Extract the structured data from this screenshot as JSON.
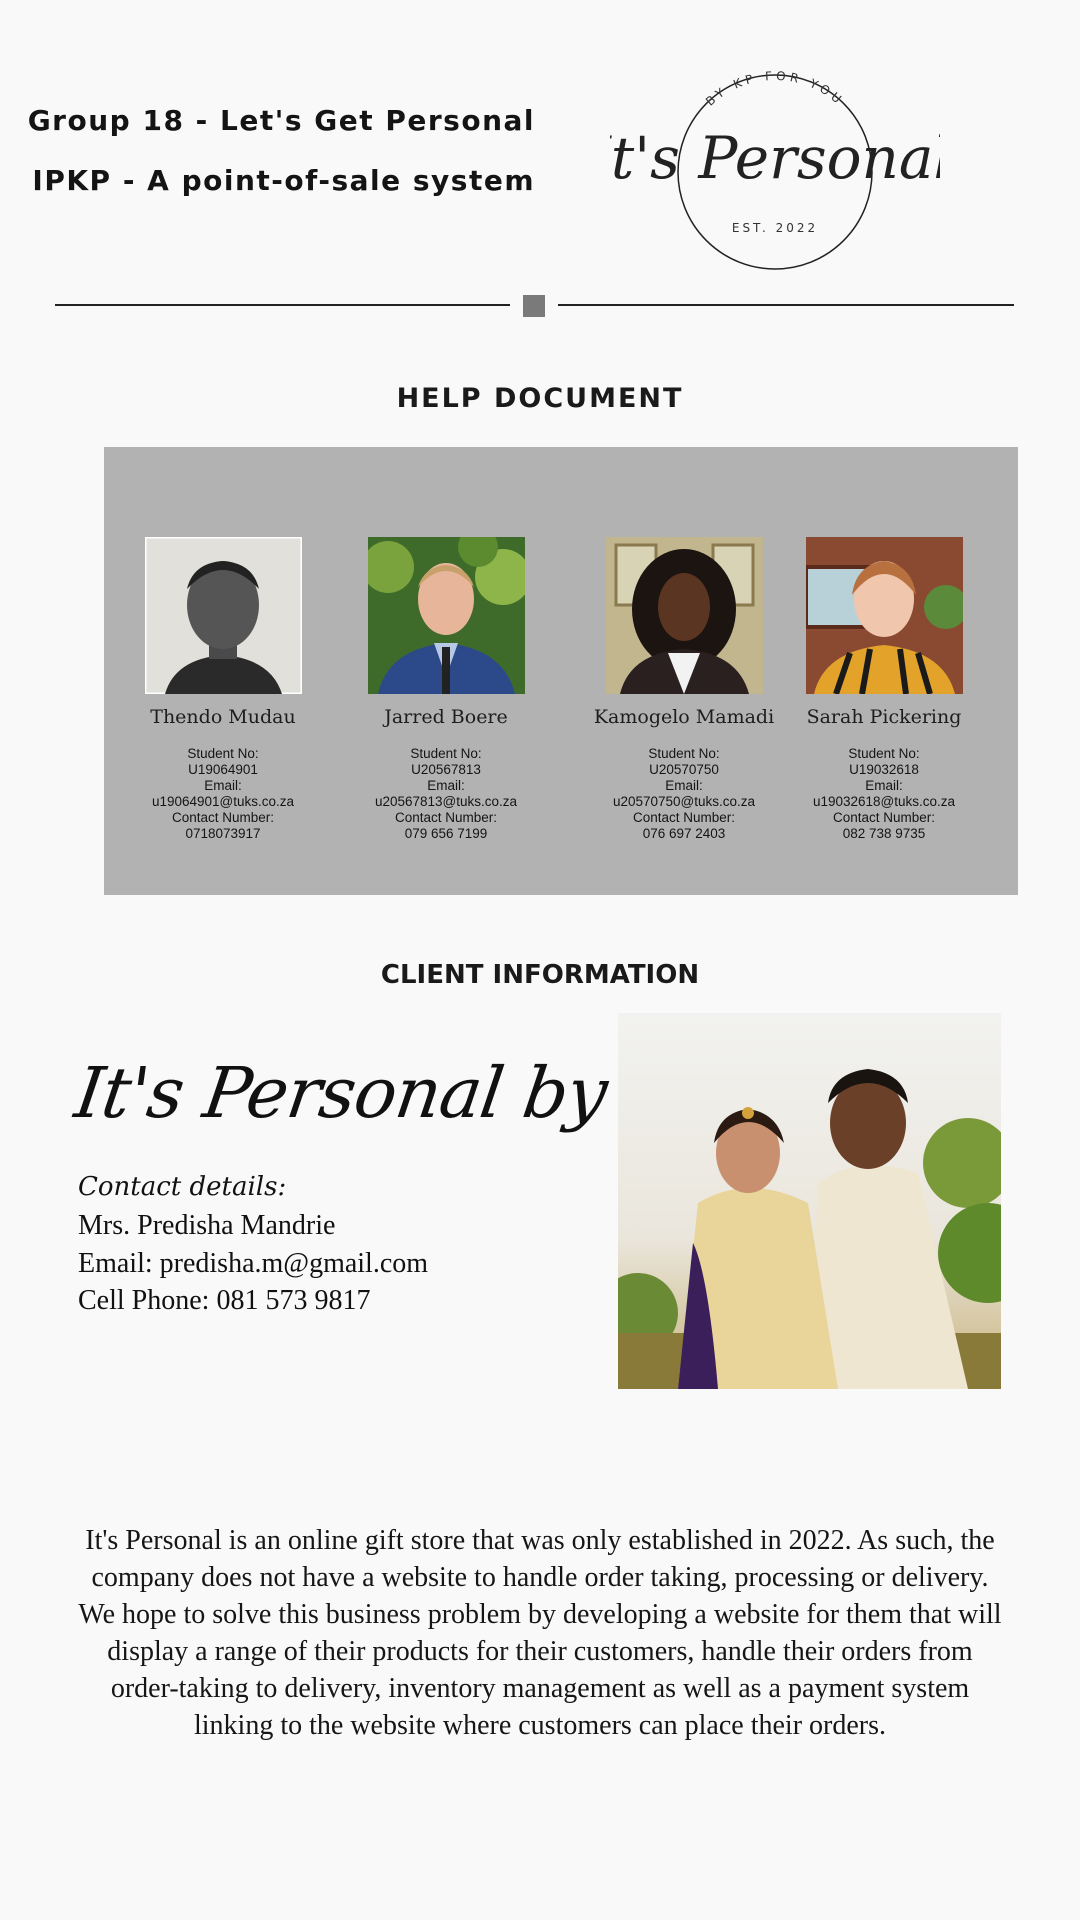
{
  "header": {
    "line1": "Group 18 - Let's Get Personal",
    "line2": "IPKP - A point-of-sale system"
  },
  "logo": {
    "arc_text": "BY KP FOR YOU",
    "script_text": "It's Personal",
    "est_text": "EST. 2022"
  },
  "help_title": "HELP DOCUMENT",
  "team": [
    {
      "name": "Thendo Mudau",
      "student_no_label": "Student No:",
      "student_no": "U19064901",
      "email_label": "Email:",
      "email": "u19064901@tuks.co.za",
      "contact_label": "Contact Number:",
      "contact": "0718073917"
    },
    {
      "name": "Jarred Boere",
      "student_no_label": "Student No:",
      "student_no": "U20567813",
      "email_label": "Email:",
      "email": "u20567813@tuks.co.za",
      "contact_label": "Contact Number:",
      "contact": "079 656 7199"
    },
    {
      "name": "Kamogelo Mamadi",
      "student_no_label": "Student No:",
      "student_no": "U20570750",
      "email_label": "Email:",
      "email": "u20570750@tuks.co.za",
      "contact_label": "Contact Number:",
      "contact": "076 697 2403"
    },
    {
      "name": "Sarah Pickering",
      "student_no_label": "Student No:",
      "student_no": "U19032618",
      "email_label": "Email:",
      "email": "u19032618@tuks.co.za",
      "contact_label": "Contact Number:",
      "contact": "082 738 9735"
    }
  ],
  "client": {
    "title": "CLIENT INFORMATION",
    "brand": "It's Personal by KP",
    "contact_label": "Contact details:",
    "name": "Mrs. Predisha Mandrie",
    "email": "Email: predisha.m@gmail.com",
    "phone": "Cell Phone: 081 573 9817"
  },
  "description": "It's Personal is an online gift store that was only established in 2022. As such, the company does not have a website to handle order taking, processing or delivery. We hope to solve this business problem by developing a website for them that will display a range of their products for their customers, handle their orders from order-taking to delivery, inventory management as well as a payment system linking to the website where customers can place their orders.",
  "colors": {
    "background": "#f9f9f9",
    "panel": "#b2b2b2",
    "divider_square": "#7a7a7a"
  }
}
